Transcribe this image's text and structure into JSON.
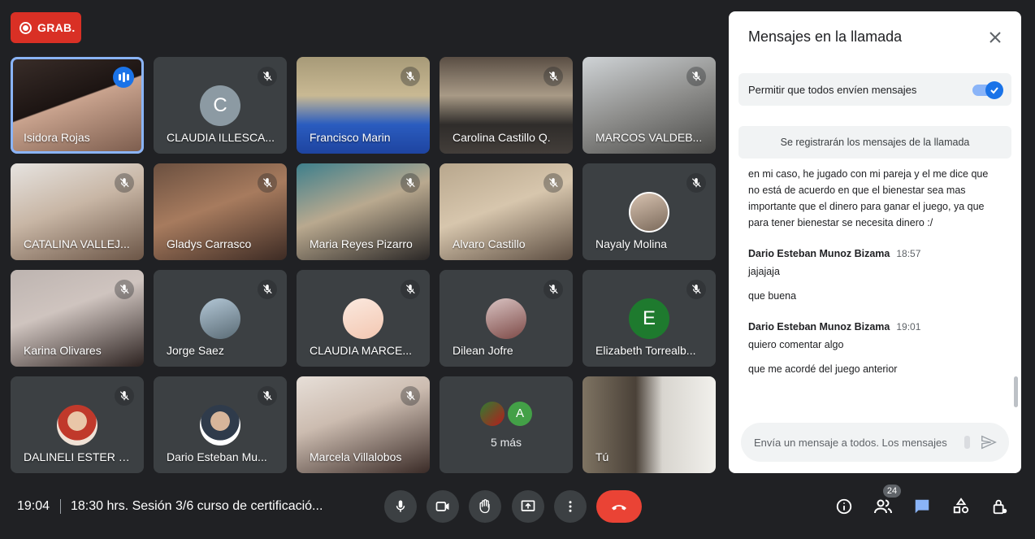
{
  "recording": {
    "label": "GRAB."
  },
  "participants": [
    {
      "name": "Isidora Rojas",
      "speaking": true,
      "view": "video"
    },
    {
      "name": "CLAUDIA ILLESCA...",
      "muted": true,
      "view": "avatar",
      "initial": "C"
    },
    {
      "name": "Francisco Marin",
      "muted": true,
      "view": "video"
    },
    {
      "name": "Carolina Castillo Q.",
      "muted": true,
      "view": "video"
    },
    {
      "name": "MARCOS VALDEB...",
      "muted": true,
      "view": "video"
    },
    {
      "name": "CATALINA VALLEJ...",
      "muted": true,
      "view": "video"
    },
    {
      "name": "Gladys Carrasco",
      "muted": true,
      "view": "video"
    },
    {
      "name": "Maria Reyes Pizarro",
      "muted": true,
      "view": "video"
    },
    {
      "name": "Alvaro Castillo",
      "muted": true,
      "view": "video"
    },
    {
      "name": "Nayaly Molina",
      "muted": true,
      "view": "avatar"
    },
    {
      "name": "Karina Olivares",
      "muted": true,
      "view": "video"
    },
    {
      "name": "Jorge Saez",
      "muted": true,
      "view": "avatar"
    },
    {
      "name": "CLAUDIA MARCE...",
      "muted": true,
      "view": "avatar"
    },
    {
      "name": "Dilean Jofre",
      "muted": true,
      "view": "avatar"
    },
    {
      "name": "Elizabeth Torrealb...",
      "muted": true,
      "view": "avatar",
      "initial": "E"
    },
    {
      "name": "DALINELI ESTER P...",
      "muted": true,
      "view": "avatar"
    },
    {
      "name": "Dario Esteban Mu...",
      "muted": true,
      "view": "avatar"
    },
    {
      "name": "Marcela Villalobos",
      "muted": true,
      "view": "video"
    },
    {
      "name": "5 más",
      "view": "more",
      "initial": "A"
    },
    {
      "name": "Tú",
      "view": "video"
    }
  ],
  "chat": {
    "title": "Mensajes en la llamada",
    "allow_label": "Permitir que todos envíen mensajes",
    "allow_enabled": true,
    "record_note": "Se registrarán los mensajes de la llamada",
    "messages": [
      {
        "text": "en mi caso, he jugado con mi pareja y el me dice que no está de acuerdo en que el bienestar sea mas importante que el dinero para ganar el juego, ya que para tener bienestar se necesita dinero :/"
      },
      {
        "sender": "Dario Esteban Munoz Bizama",
        "time": "18:57",
        "texts": [
          "jajajaja",
          "que buena"
        ]
      },
      {
        "sender": "Dario Esteban Munoz Bizama",
        "time": "19:01",
        "texts": [
          "quiero comentar algo",
          "que me acordé del juego anterior"
        ]
      }
    ],
    "input_placeholder": "Envía un mensaje a todos. Los mensajes"
  },
  "bottom": {
    "time": "19:04",
    "meeting_title": "18:30 hrs. Sesión 3/6 curso de certificació...",
    "people_count": "24"
  },
  "colors": {
    "accent": "#1a73e8",
    "record": "#d93025",
    "hangup": "#ea4335",
    "background": "#202124",
    "tile": "#3c4043"
  }
}
